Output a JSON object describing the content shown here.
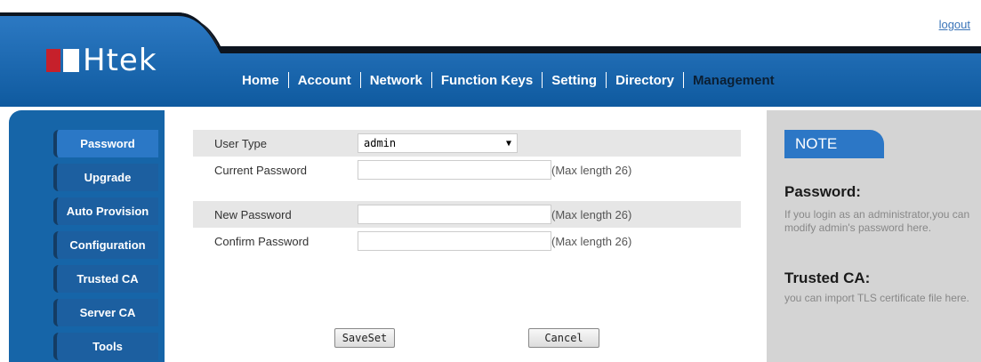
{
  "header": {
    "logout": "logout",
    "logo_text": "Htek",
    "nav": [
      "Home",
      "Account",
      "Network",
      "Function Keys",
      "Setting",
      "Directory",
      "Management"
    ],
    "active_nav": "Management"
  },
  "sidebar": {
    "items": [
      "Password",
      "Upgrade",
      "Auto Provision",
      "Configuration",
      "Trusted CA",
      "Server CA",
      "Tools"
    ],
    "active": "Password"
  },
  "form": {
    "user_type_label": "User Type",
    "user_type_value": "admin",
    "current_password_label": "Current Password",
    "current_password_hint": "(Max length 26)",
    "new_password_label": "New Password",
    "new_password_hint": "(Max length 26)",
    "confirm_password_label": "Confirm Password",
    "confirm_password_hint": "(Max length 26)",
    "save_label": "SaveSet",
    "cancel_label": "Cancel"
  },
  "note": {
    "tab": "NOTE",
    "sections": [
      {
        "title": "Password:",
        "text": "If you login as an administrator,you can modify admin's password here."
      },
      {
        "title": "Trusted CA:",
        "text": "you can import TLS certificate file here."
      }
    ]
  },
  "colors": {
    "brand_blue": "#1665a8",
    "header_dark": "#0d1520",
    "accent_red": "#c6202b"
  }
}
